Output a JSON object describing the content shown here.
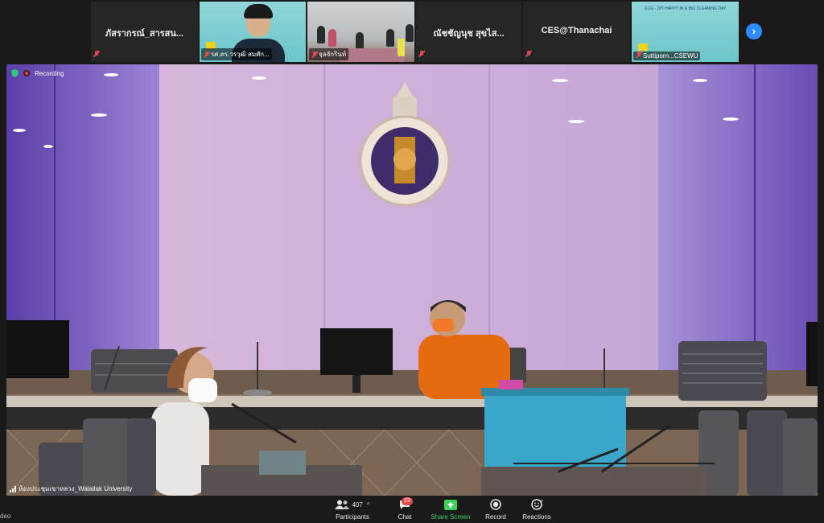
{
  "gallery": {
    "tiles": [
      {
        "name": "ภัสรากรณ์_สารสน..."
      },
      {
        "label": "รศ.ดร.วรวุฒิ สมศัก..."
      },
      {
        "label": "จุลจักรินท์"
      },
      {
        "name": "ณัชชัญนุช สุขไส..."
      },
      {
        "name": "CES@Thanachai"
      },
      {
        "label": "Suttiporn...CSEWU",
        "banner": "GCG · DIY HAPPY IN & BIG CLEANING DAY"
      }
    ]
  },
  "main_video": {
    "recording_label": "Recording",
    "room_name": "ห้องประชุมเขาหลวง_Walailak University"
  },
  "toolbar": {
    "cut_label": "deo",
    "participants_label": "Participants",
    "participants_count": "407",
    "chat_label": "Chat",
    "chat_badge": "23",
    "share_label": "Share Screen",
    "record_label": "Record",
    "reactions_label": "Reactions"
  },
  "colors": {
    "accent": "#2d8cff",
    "share_green": "#3ad35c",
    "alert_red": "#e5484d",
    "background": "#1a1a1a"
  }
}
